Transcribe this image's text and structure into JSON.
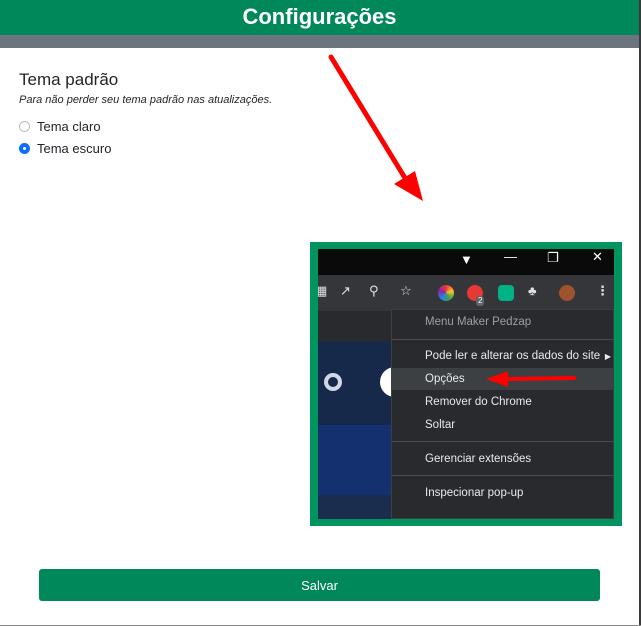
{
  "header": {
    "title": "Configurações"
  },
  "settings": {
    "section_title": "Tema padrão",
    "section_subtitle": "Para não perder seu tema padrão nas atualizações.",
    "options": [
      {
        "label": "Tema claro",
        "checked": false
      },
      {
        "label": "Tema escuro",
        "checked": true
      }
    ]
  },
  "inset": {
    "badge_count": "2",
    "menu": {
      "header": "Menu Maker Pedzap",
      "items": [
        "Pode ler e alterar os dados do site",
        "Opções",
        "Remover do Chrome",
        "Soltar",
        "Gerenciar extensões",
        "Inspecionar pop-up"
      ]
    }
  },
  "footer": {
    "save_label": "Salvar"
  },
  "colors": {
    "brand": "#00875a",
    "arrow": "#ff0000",
    "radio_checked": "#0d6efd"
  }
}
